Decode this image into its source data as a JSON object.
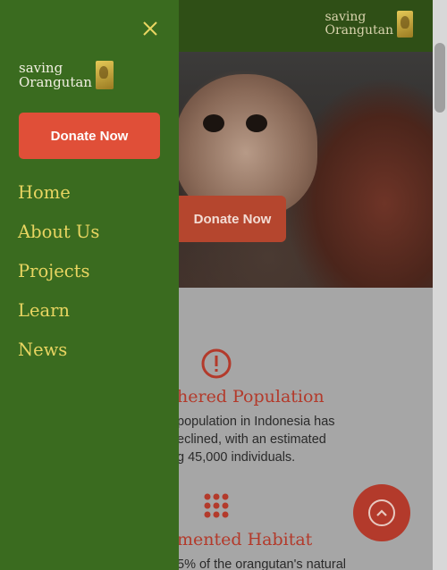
{
  "header": {
    "brand_line1": "saving",
    "brand_line2": "Orangutan"
  },
  "hero": {
    "donate_label": "Donate Now"
  },
  "features": [
    {
      "icon": "exclamation-circle-icon",
      "title": "hered Population",
      "lines": [
        "population in Indonesia has",
        "eclined, with an estimated",
        "g 45,000 individuals."
      ]
    },
    {
      "icon": "dots-grid-icon",
      "title": "mented Habitat",
      "lines": [
        "5% of the orangutan's natural"
      ]
    }
  ],
  "drawer": {
    "brand_line1": "saving",
    "brand_line2": "Orangutan",
    "donate_label": "Donate Now",
    "nav": [
      "Home",
      "About Us",
      "Projects",
      "Learn",
      "News"
    ]
  },
  "colors": {
    "drawer_bg": "#3a6b1f",
    "accent": "#e04f38",
    "nav_text": "#e8d561",
    "feature_red": "#b33a2b"
  }
}
